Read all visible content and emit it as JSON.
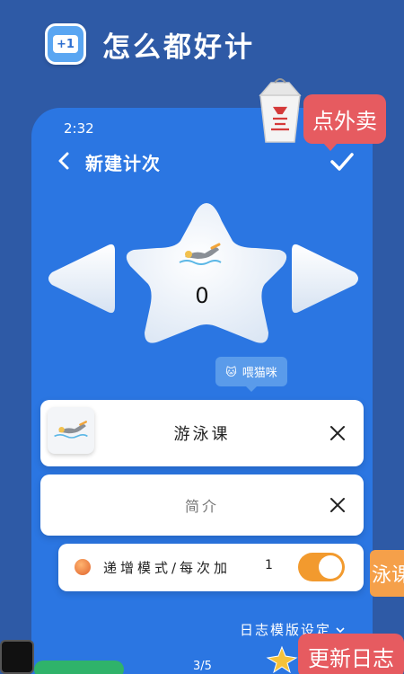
{
  "app": {
    "title": "怎么都好计",
    "logo_text": "+1"
  },
  "status": {
    "time": "2:32"
  },
  "nav": {
    "title": "新建计次",
    "back_icon": "chevron-left-icon",
    "confirm_icon": "check-icon"
  },
  "counter": {
    "value": "0",
    "icon": "swim-icon"
  },
  "cat_badge": {
    "text": "喂猫咪"
  },
  "name_card": {
    "value": "游泳课"
  },
  "intro_card": {
    "placeholder": "简介"
  },
  "mode_card": {
    "label": "递增模式/每次加",
    "value": "1",
    "toggle_on": true
  },
  "template_link": {
    "label": "日志模版设定",
    "icon": "chevron-down-icon"
  },
  "pager": {
    "text": "3/5"
  },
  "promos": {
    "takeout": "点外卖",
    "swim": "泳课",
    "update": "更新日志"
  },
  "colors": {
    "page_bg": "#2e5aa6",
    "phone_bg": "#2b76e2",
    "toggle": "#f29a2e",
    "promo_red": "#e65b60"
  }
}
